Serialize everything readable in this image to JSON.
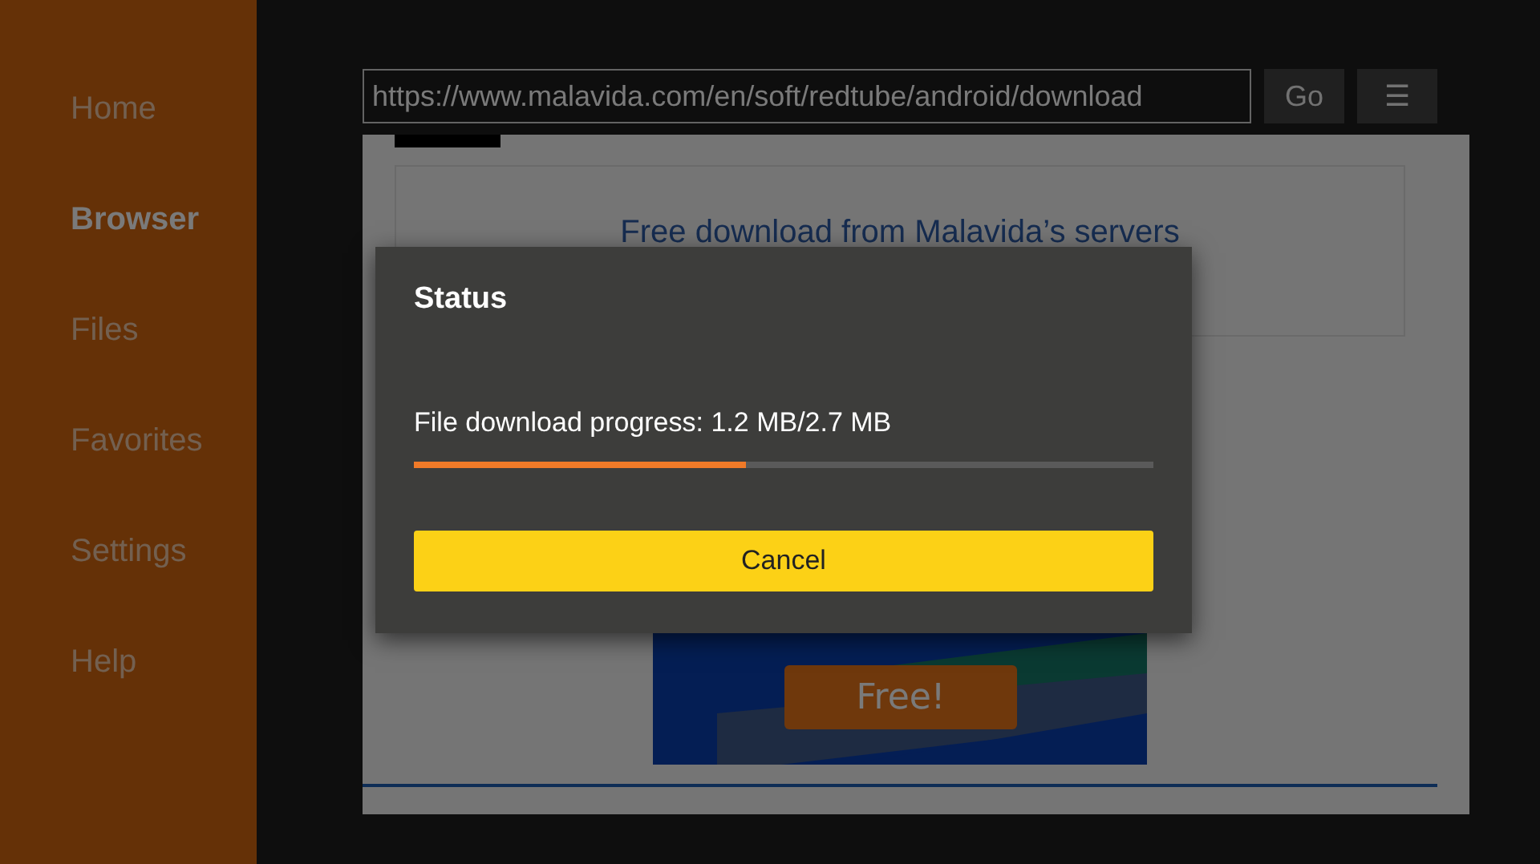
{
  "sidebar": {
    "items": [
      {
        "label": "Home",
        "selected": false
      },
      {
        "label": "Browser",
        "selected": true
      },
      {
        "label": "Files",
        "selected": false
      },
      {
        "label": "Favorites",
        "selected": false
      },
      {
        "label": "Settings",
        "selected": false
      },
      {
        "label": "Help",
        "selected": false
      }
    ]
  },
  "address_bar": {
    "value": "https://www.malavida.com/en/soft/redtube/android/download"
  },
  "go_button": "Go",
  "menu_button": "☰",
  "webpage": {
    "download_link": "Free download from Malavida’s servers",
    "ad_button": "Free!"
  },
  "dialog": {
    "title": "Status",
    "message": "File download progress: 1.2 MB/2.7 MB",
    "progress": {
      "level": 0.45
    },
    "button": "Cancel"
  }
}
